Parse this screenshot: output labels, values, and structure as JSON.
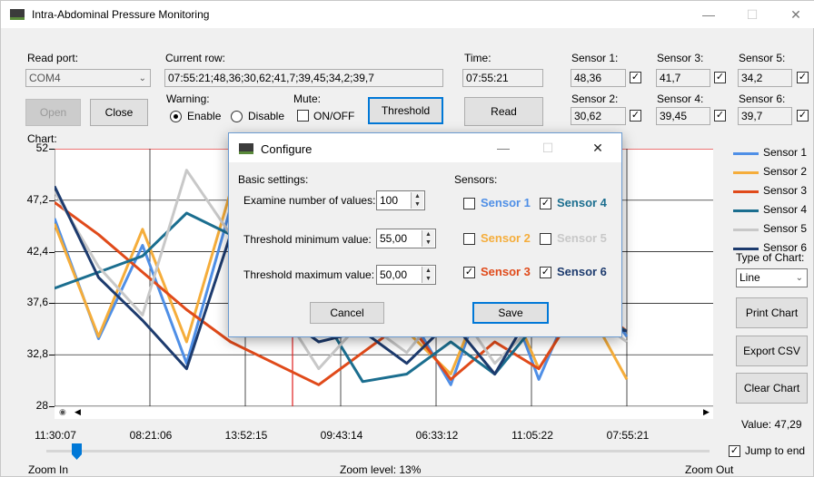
{
  "window": {
    "title": "Intra-Abdominal Pressure Monitoring"
  },
  "controls": {
    "read_port_label": "Read port:",
    "port_value": "COM4",
    "current_row_label": "Current row:",
    "current_row_value": "07:55:21;48,36;30,62;41,7;39,45;34,2;39,7",
    "time_label": "Time:",
    "time_value": "07:55:21",
    "open_label": "Open",
    "close_label": "Close",
    "warning_label": "Warning:",
    "enable_label": "Enable",
    "disable_label": "Disable",
    "mute_label": "Mute:",
    "mute_onoff_label": "ON/OFF",
    "threshold_label": "Threshold",
    "read_label": "Read"
  },
  "sensors": [
    {
      "label": "Sensor 1:",
      "value": "48,36",
      "checked": true
    },
    {
      "label": "Sensor 2:",
      "value": "30,62",
      "checked": true
    },
    {
      "label": "Sensor 3:",
      "value": "41,7",
      "checked": true
    },
    {
      "label": "Sensor 4:",
      "value": "39,45",
      "checked": true
    },
    {
      "label": "Sensor 5:",
      "value": "34,2",
      "checked": true
    },
    {
      "label": "Sensor 6:",
      "value": "39,7",
      "checked": true
    }
  ],
  "chart_label": "Chart:",
  "legend": [
    {
      "name": "Sensor 1",
      "color": "#4f8fe6"
    },
    {
      "name": "Sensor 2",
      "color": "#f5ad3b"
    },
    {
      "name": "Sensor 3",
      "color": "#e04a1a"
    },
    {
      "name": "Sensor 4",
      "color": "#1b6e8f"
    },
    {
      "name": "Sensor 5",
      "color": "#c8c8c8"
    },
    {
      "name": "Sensor 6",
      "color": "#1d3b6e"
    }
  ],
  "side": {
    "type_label": "Type of Chart:",
    "type_value": "Line",
    "print_label": "Print Chart",
    "export_label": "Export CSV",
    "clear_label": "Clear Chart",
    "value_label": "Value: 47,29",
    "jump_label": "Jump to end"
  },
  "zoom": {
    "in_label": "Zoom In",
    "level_label": "Zoom level: 13%",
    "out_label": "Zoom Out",
    "level": 0.13
  },
  "dialog": {
    "title": "Configure",
    "basic_label": "Basic settings:",
    "examine_label": "Examine number of values:",
    "examine_value": "100",
    "tmin_label": "Threshold minimum value:",
    "tmin_value": "55,00",
    "tmax_label": "Threshold maximum value:",
    "tmax_value": "50,00",
    "sensors_label": "Sensors:",
    "sensor_checks": [
      {
        "name": "Sensor 1",
        "checked": false,
        "color": "#4f8fe6"
      },
      {
        "name": "Sensor 4",
        "checked": true,
        "color": "#1b6e8f"
      },
      {
        "name": "Sensor 2",
        "checked": false,
        "color": "#f5ad3b"
      },
      {
        "name": "Sensor 5",
        "checked": false,
        "color": "#c8c8c8"
      },
      {
        "name": "Sensor 3",
        "checked": true,
        "color": "#e04a1a"
      },
      {
        "name": "Sensor 6",
        "checked": true,
        "color": "#1d3b6e"
      }
    ],
    "cancel_label": "Cancel",
    "save_label": "Save"
  },
  "chart_data": {
    "type": "line",
    "y_ticks": [
      "52",
      "47,2",
      "42,4",
      "37,6",
      "32,8",
      "28"
    ],
    "ylim": [
      28,
      52
    ],
    "x_ticks": [
      "11:30:07",
      "08:21:06",
      "13:52:15",
      "09:43:14",
      "06:33:12",
      "11:05:22",
      "07:55:21"
    ],
    "threshold_line": 52,
    "series": [
      {
        "name": "Sensor 1",
        "color": "#4f8fe6",
        "values": [
          45.5,
          34.3,
          43.0,
          32.0,
          46.5,
          40.0,
          41.0,
          39.0,
          37.0,
          30.0,
          41.5,
          30.5,
          40.0,
          34.5
        ]
      },
      {
        "name": "Sensor 2",
        "color": "#f5ad3b",
        "values": [
          45.0,
          34.5,
          44.5,
          34.0,
          48.0,
          38.0,
          40.0,
          39.0,
          35.0,
          31.0,
          41.0,
          31.5,
          38.0,
          30.5
        ]
      },
      {
        "name": "Sensor 3",
        "color": "#e04a1a",
        "values": [
          47.0,
          44.0,
          40.5,
          37.0,
          34.0,
          32.0,
          30.0,
          33.0,
          36.0,
          30.5,
          34.0,
          31.5,
          38.0,
          35.0
        ]
      },
      {
        "name": "Sensor 4",
        "color": "#1b6e8f",
        "values": [
          39.0,
          40.5,
          42.0,
          46.0,
          44.0,
          38.0,
          37.0,
          30.3,
          31.0,
          34.0,
          31.0,
          36.0,
          37.0,
          35.0
        ]
      },
      {
        "name": "Sensor 5",
        "color": "#c8c8c8",
        "values": [
          48.0,
          41.0,
          36.5,
          50.0,
          44.0,
          38.0,
          31.5,
          36.0,
          33.0,
          38.0,
          32.0,
          36.0,
          37.0,
          34.0
        ]
      },
      {
        "name": "Sensor 6",
        "color": "#1d3b6e",
        "values": [
          48.5,
          40.0,
          36.0,
          31.5,
          44.0,
          37.0,
          34.0,
          35.0,
          32.0,
          36.0,
          31.0,
          38.0,
          36.0,
          35.0
        ]
      }
    ]
  }
}
